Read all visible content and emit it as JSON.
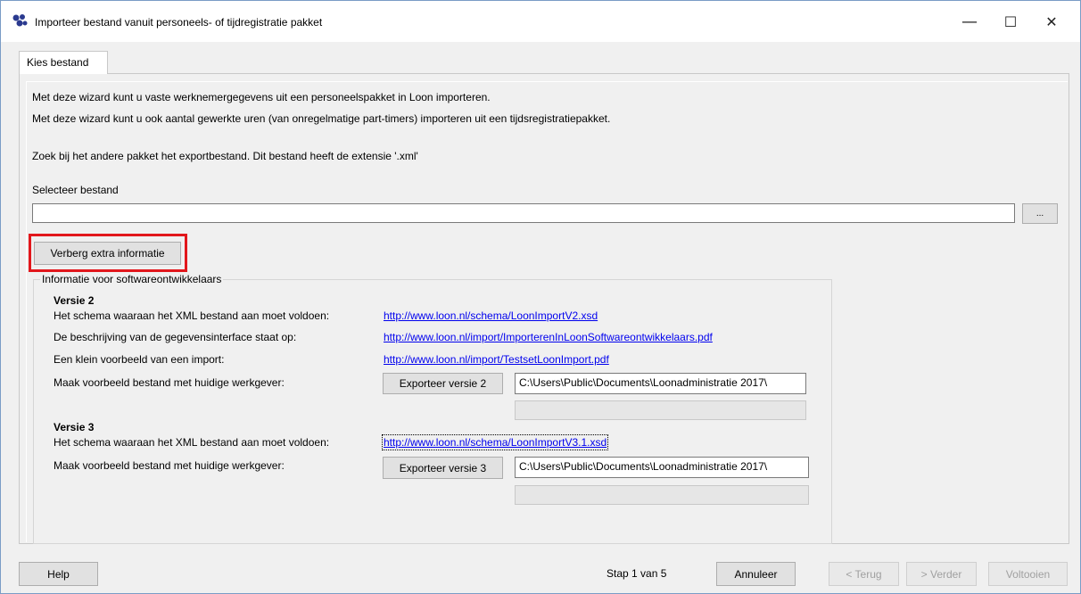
{
  "window": {
    "title": "Importeer bestand vanuit personeels- of tijdregistratie pakket",
    "controls": {
      "minimize": "—",
      "maximize": "☐",
      "close": "✕"
    }
  },
  "tab": {
    "label": "Kies bestand"
  },
  "intro": {
    "line1": "Met deze wizard kunt u vaste werknemergegevens uit een personeelspakket in Loon importeren.",
    "line2": "Met deze wizard kunt u ook aantal gewerkte uren (van onregelmatige part-timers) importeren uit een tijdsregistratiepakket.",
    "line3": "Zoek bij het andere pakket het exportbestand. Dit bestand heeft de extensie '.xml'"
  },
  "file_select": {
    "label": "Selecteer bestand",
    "value": "",
    "browse_label": "..."
  },
  "toggle_info_button": "Verberg extra informatie",
  "dev_info": {
    "legend": "Informatie voor softwareontwikkelaars",
    "v2": {
      "heading": "Versie 2",
      "schema_label": "Het schema waaraan het XML bestand aan moet voldoen:",
      "schema_link": "http://www.loon.nl/schema/LoonImportV2.xsd",
      "desc_label": "De beschrijving van de gegevensinterface staat op:",
      "desc_link": "http://www.loon.nl/import/ImporterenInLoonSoftwareontwikkelaars.pdf",
      "example_label": "Een klein voorbeeld van een import:",
      "example_link": "http://www.loon.nl/import/TestsetLoonImport.pdf",
      "make_label": "Maak voorbeeld bestand met huidige werkgever:",
      "export_button": "Exporteer versie 2",
      "path": "C:\\Users\\Public\\Documents\\Loonadministratie 2017\\"
    },
    "v3": {
      "heading": "Versie 3",
      "schema_label": "Het schema waaraan het XML bestand aan moet voldoen:",
      "schema_link": "http://www.loon.nl/schema/LoonImportV3.1.xsd",
      "make_label": "Maak voorbeeld bestand met huidige werkgever:",
      "export_button": "Exporteer versie 3",
      "path": "C:\\Users\\Public\\Documents\\Loonadministratie 2017\\"
    }
  },
  "footer": {
    "help": "Help",
    "step": "Stap  1 van 5",
    "cancel": "Annuleer",
    "back": "< Terug",
    "next": "> Verder",
    "finish": "Voltooien"
  }
}
